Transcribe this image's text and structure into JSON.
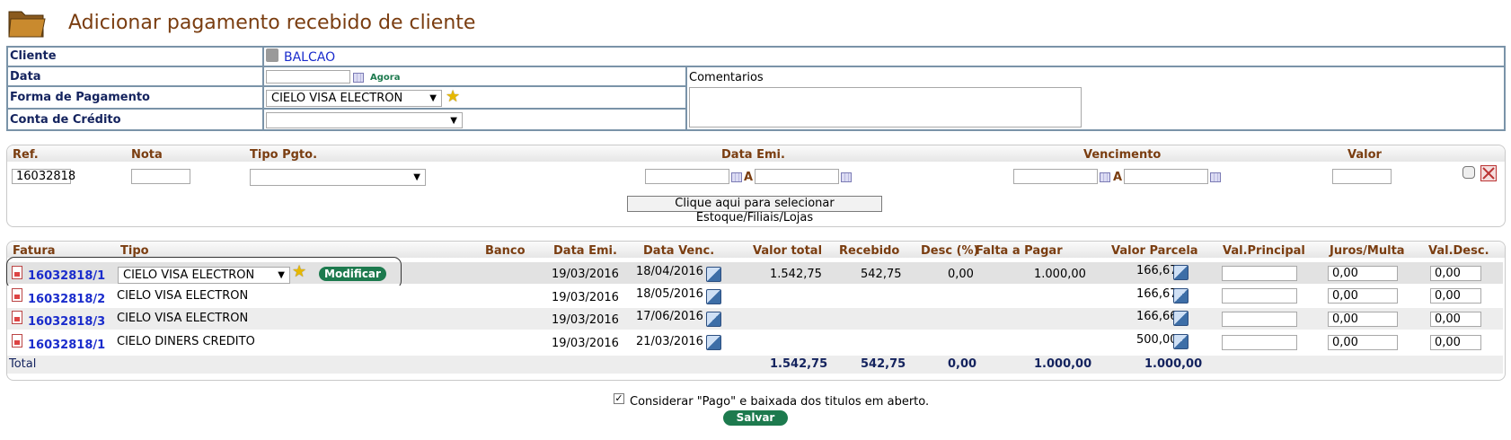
{
  "page": {
    "title": "Adicionar pagamento recebido de cliente",
    "icon": "folder-icon"
  },
  "form": {
    "cliente_label": "Cliente",
    "cliente_value": "BALCAO",
    "data_label": "Data",
    "data_value": "",
    "agora_link": "Agora",
    "forma_label": "Forma de Pagamento",
    "forma_value": "CIELO VISA ELECTRON",
    "conta_label": "Conta de Crédito",
    "conta_value": "",
    "comentarios_label": "Comentarios",
    "comentarios_value": ""
  },
  "filter": {
    "ref_label": "Ref.",
    "ref_value": "16032818",
    "nota_label": "Nota",
    "tipo_label": "Tipo Pgto.",
    "data_emi_label": "Data Emi.",
    "vencimento_label": "Vencimento",
    "valor_label": "Valor",
    "range_sep": "A",
    "estoque_button": "Clique aqui para selecionar Estoque/Filiais/Lojas"
  },
  "table": {
    "headers": [
      "Fatura",
      "Tipo",
      "Banco",
      "Data Emi.",
      "Data Venc.",
      "Valor total",
      "Recebido",
      "Desc (%)",
      "Falta a Pagar",
      "Valor Parcela",
      "Val.Principal",
      "Juros/Multa",
      "Val.Desc."
    ],
    "modify_button": "Modificar",
    "rows": [
      {
        "fatura": "16032818/1",
        "tipo": "CIELO VISA ELECTRON",
        "data_emi": "19/03/2016",
        "data_venc": "18/04/2016",
        "valor_total": "1.542,75",
        "recebido": "542,75",
        "desc": "0,00",
        "falta": "1.000,00",
        "parcela": "166,67",
        "juros": "0,00",
        "val_desc": "0,00"
      },
      {
        "fatura": "16032818/2",
        "tipo": "CIELO VISA ELECTRON",
        "data_emi": "19/03/2016",
        "data_venc": "18/05/2016",
        "parcela": "166,67",
        "juros": "0,00",
        "val_desc": "0,00"
      },
      {
        "fatura": "16032818/3",
        "tipo": "CIELO VISA ELECTRON",
        "data_emi": "19/03/2016",
        "data_venc": "17/06/2016",
        "parcela": "166,66",
        "juros": "0,00",
        "val_desc": "0,00"
      },
      {
        "fatura": "16032818/1",
        "tipo": "CIELO DINERS CREDITO",
        "data_emi": "19/03/2016",
        "data_venc": "21/03/2016",
        "parcela": "500,00",
        "juros": "0,00",
        "val_desc": "0,00"
      }
    ],
    "total": {
      "label": "Total",
      "valor_total": "1.542,75",
      "recebido": "542,75",
      "desc": "0,00",
      "falta": "1.000,00",
      "parcela": "1.000,00"
    }
  },
  "footer": {
    "checkbox_label": "Considerar \"Pago\" e baixada dos titulos em aberto.",
    "checkbox_checked": true,
    "save_button": "Salvar"
  }
}
